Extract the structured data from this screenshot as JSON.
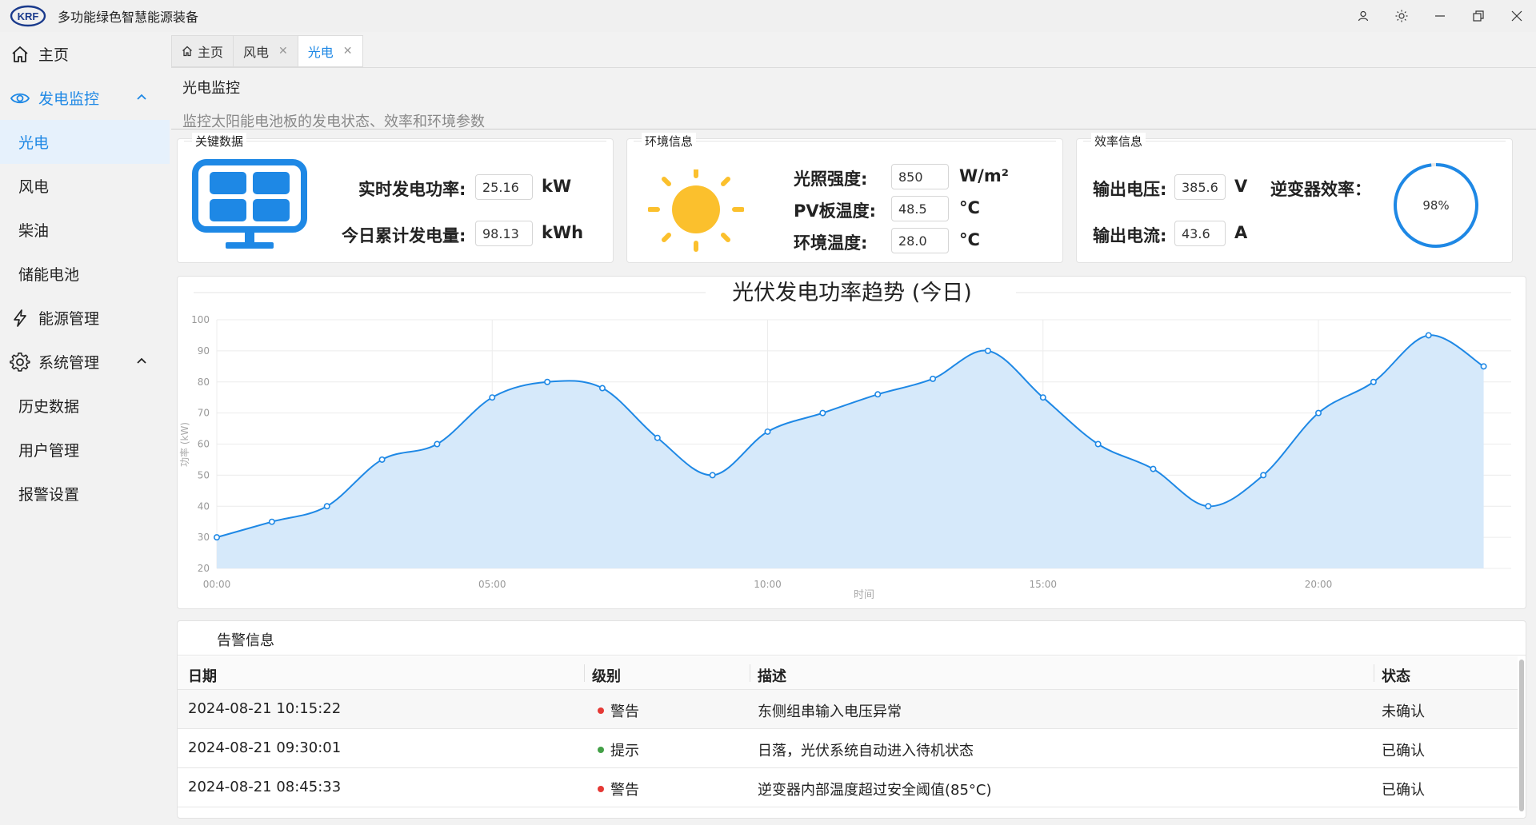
{
  "app": {
    "title": "多功能绿色智慧能源装备",
    "logo_text": "KRF"
  },
  "window_controls": [
    "user-icon",
    "theme-icon",
    "minimize-icon",
    "restore-icon",
    "close-icon"
  ],
  "sidebar": {
    "items": [
      {
        "label": "主页",
        "icon": "home-icon"
      },
      {
        "label": "发电监控",
        "icon": "eye-icon",
        "expanded": true
      },
      {
        "label": "光电",
        "active": true
      },
      {
        "label": "风电"
      },
      {
        "label": "柴油"
      },
      {
        "label": "储能电池"
      },
      {
        "label": "能源管理",
        "icon": "lightning-icon"
      },
      {
        "label": "系统管理",
        "icon": "gear-icon",
        "expanded": true
      },
      {
        "label": "历史数据"
      },
      {
        "label": "用户管理"
      },
      {
        "label": "报警设置"
      }
    ]
  },
  "tabs": [
    {
      "label": "主页",
      "icon": "home-icon"
    },
    {
      "label": "风电",
      "closable": true
    },
    {
      "label": "光电",
      "closable": true,
      "active": true
    }
  ],
  "page": {
    "title": "光电监控",
    "subtitle": "监控太阳能电池板的发电状态、效率和环境参数"
  },
  "key_data": {
    "legend": "关键数据",
    "power_label": "实时发电功率:",
    "power_value": "25.16",
    "power_unit": "kW",
    "energy_label": "今日累计发电量:",
    "energy_value": "98.13",
    "energy_unit": "kWh"
  },
  "env_info": {
    "legend": "环境信息",
    "irradiance_label": "光照强度:",
    "irradiance_value": "850",
    "irradiance_unit": "W/m²",
    "pv_temp_label": "PV板温度:",
    "pv_temp_value": "48.5",
    "pv_temp_unit": "°C",
    "ambient_label": "环境温度:",
    "ambient_value": "28.0",
    "ambient_unit": "°C"
  },
  "eff_info": {
    "legend": "效率信息",
    "voltage_label": "输出电压:",
    "voltage_value": "385.6",
    "voltage_unit": "V",
    "current_label": "输出电流:",
    "current_value": "43.6",
    "current_unit": "A",
    "inverter_label": "逆变器效率：",
    "inverter_value": "98%",
    "inverter_fraction": 0.98
  },
  "chart_data": {
    "type": "area",
    "title": "光伏发电功率趋势 (今日)",
    "xlabel": "时间",
    "ylabel": "功率 (kW)",
    "ylim": [
      20,
      100
    ],
    "yticks": [
      20,
      30,
      40,
      50,
      60,
      70,
      80,
      90,
      100
    ],
    "xticks": [
      "00:00",
      "05:00",
      "10:00",
      "15:00",
      "20:00"
    ],
    "x": [
      0,
      1,
      2,
      3,
      4,
      5,
      6,
      7,
      8,
      9,
      10,
      11,
      12,
      13,
      14,
      15,
      16,
      17,
      18,
      19,
      20,
      21,
      22,
      23
    ],
    "values": [
      30,
      35,
      40,
      55,
      60,
      75,
      80,
      78,
      62,
      50,
      64,
      70,
      76,
      81,
      90,
      75,
      60,
      52,
      40,
      50,
      70,
      80,
      95,
      85
    ],
    "grid": true,
    "color": "#1e88e5",
    "fill": "#d6e9fa"
  },
  "alarms": {
    "title": "告警信息",
    "columns": [
      "日期",
      "级别",
      "描述",
      "状态"
    ],
    "rows": [
      {
        "date": "2024-08-21 10:15:22",
        "level": "警告",
        "level_color": "#e53935",
        "desc": "东侧组串输入电压异常",
        "status": "未确认"
      },
      {
        "date": "2024-08-21 09:30:01",
        "level": "提示",
        "level_color": "#43a047",
        "desc": "日落，光伏系统自动进入待机状态",
        "status": "已确认"
      },
      {
        "date": "2024-08-21 08:45:33",
        "level": "警告",
        "level_color": "#e53935",
        "desc": "逆变器内部温度超过安全阈值(85°C)",
        "status": "已确认"
      }
    ]
  }
}
